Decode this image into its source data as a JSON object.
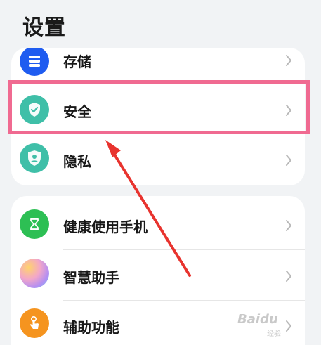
{
  "header": {
    "title": "设置"
  },
  "groups": [
    {
      "items": [
        {
          "label": "存储",
          "icon": "storage-icon",
          "color": "#1f5cf0"
        },
        {
          "label": "安全",
          "icon": "shield-check-icon",
          "color": "#3fbfa8"
        },
        {
          "label": "隐私",
          "icon": "privacy-icon",
          "color": "#3fbfa8"
        }
      ]
    },
    {
      "items": [
        {
          "label": "健康使用手机",
          "icon": "hourglass-icon",
          "color": "#2dbf54"
        },
        {
          "label": "智慧助手",
          "icon": "assistant-icon",
          "color": "#f08bb0"
        },
        {
          "label": "辅助功能",
          "icon": "hand-tap-icon",
          "color": "#f5941f"
        }
      ]
    }
  ],
  "annotation": {
    "highlight_color": "#f06a91",
    "arrow_color": "#e8332e"
  },
  "watermark": {
    "text": "Baidu",
    "sub": "经验"
  }
}
